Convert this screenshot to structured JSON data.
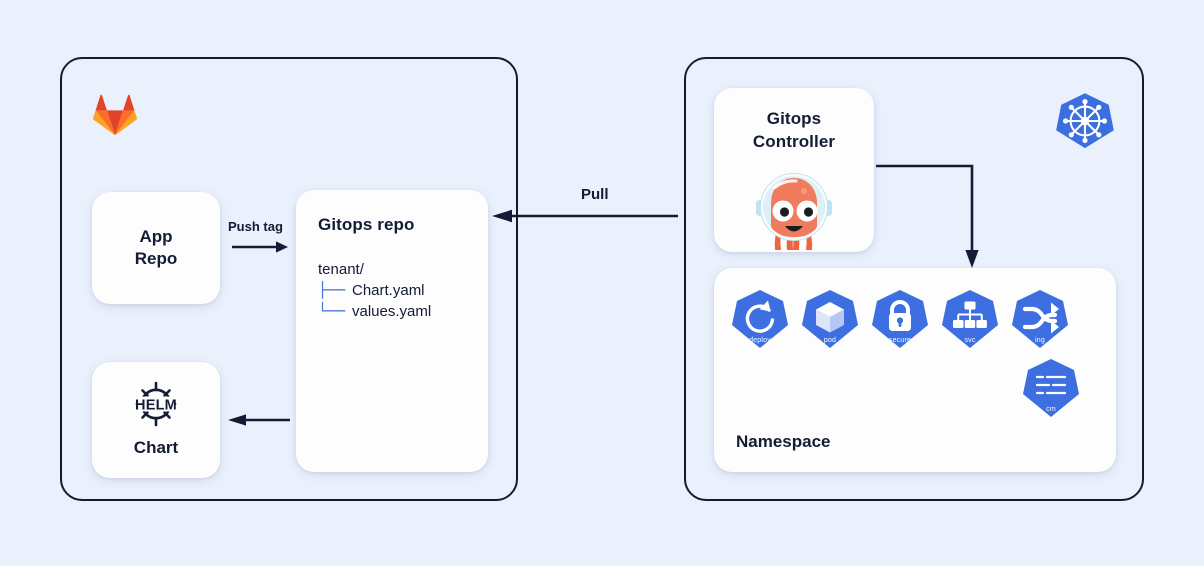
{
  "background_color": "#eaf1fd",
  "panels": [
    {
      "name": "source-panel",
      "border_color": "#131c34"
    },
    {
      "name": "cluster-panel",
      "border_color": "#131c34"
    }
  ],
  "logos": {
    "gitlab": {
      "icon": "gitlab-logo",
      "colors": [
        "#e24329",
        "#fc6d26",
        "#fca326"
      ]
    },
    "kubernetes": {
      "icon": "kubernetes-logo",
      "color": "#326ce5"
    },
    "helm": {
      "icon": "helm-logo",
      "text": "HELM",
      "color": "#0f1689"
    },
    "argo": {
      "icon": "argo-octopus-mascot",
      "colors": [
        "#ef633f",
        "#d7eef5"
      ]
    }
  },
  "cards": {
    "app_repo": {
      "line1": "App",
      "line2": "Repo"
    },
    "gitops_repo": {
      "title": "Gitops repo",
      "tree_root": "tenant/",
      "files": [
        {
          "branch": "├──",
          "name": "Chart.yaml"
        },
        {
          "branch": "└──",
          "name": "values.yaml"
        }
      ],
      "branch_color": "#4471d6"
    },
    "helm_chart": {
      "logo_text": "HELM",
      "caption": "Chart"
    },
    "gitops_controller": {
      "line1": "Gitops",
      "line2": "Controller"
    },
    "namespace": {
      "label": "Namespace",
      "resources_row1": [
        {
          "caption": "deploy",
          "icon": "deployment-icon"
        },
        {
          "caption": "pod",
          "icon": "pod-icon"
        },
        {
          "caption": "secure",
          "icon": "secret-lock-icon"
        },
        {
          "caption": "svc",
          "icon": "service-icon"
        },
        {
          "caption": "ing",
          "icon": "ingress-icon"
        }
      ],
      "resources_row2": [
        {
          "caption": "cm",
          "icon": "configmap-icon"
        }
      ],
      "hexagon_color": "#3d6fe0"
    }
  },
  "edges": {
    "push_tag": {
      "label": "Push tag",
      "direction": "right"
    },
    "pull": {
      "label": "Pull",
      "direction": "left"
    },
    "chart": {
      "label": "",
      "direction": "left"
    },
    "controller_to_namespace": {
      "label": "",
      "direction": "down"
    }
  }
}
